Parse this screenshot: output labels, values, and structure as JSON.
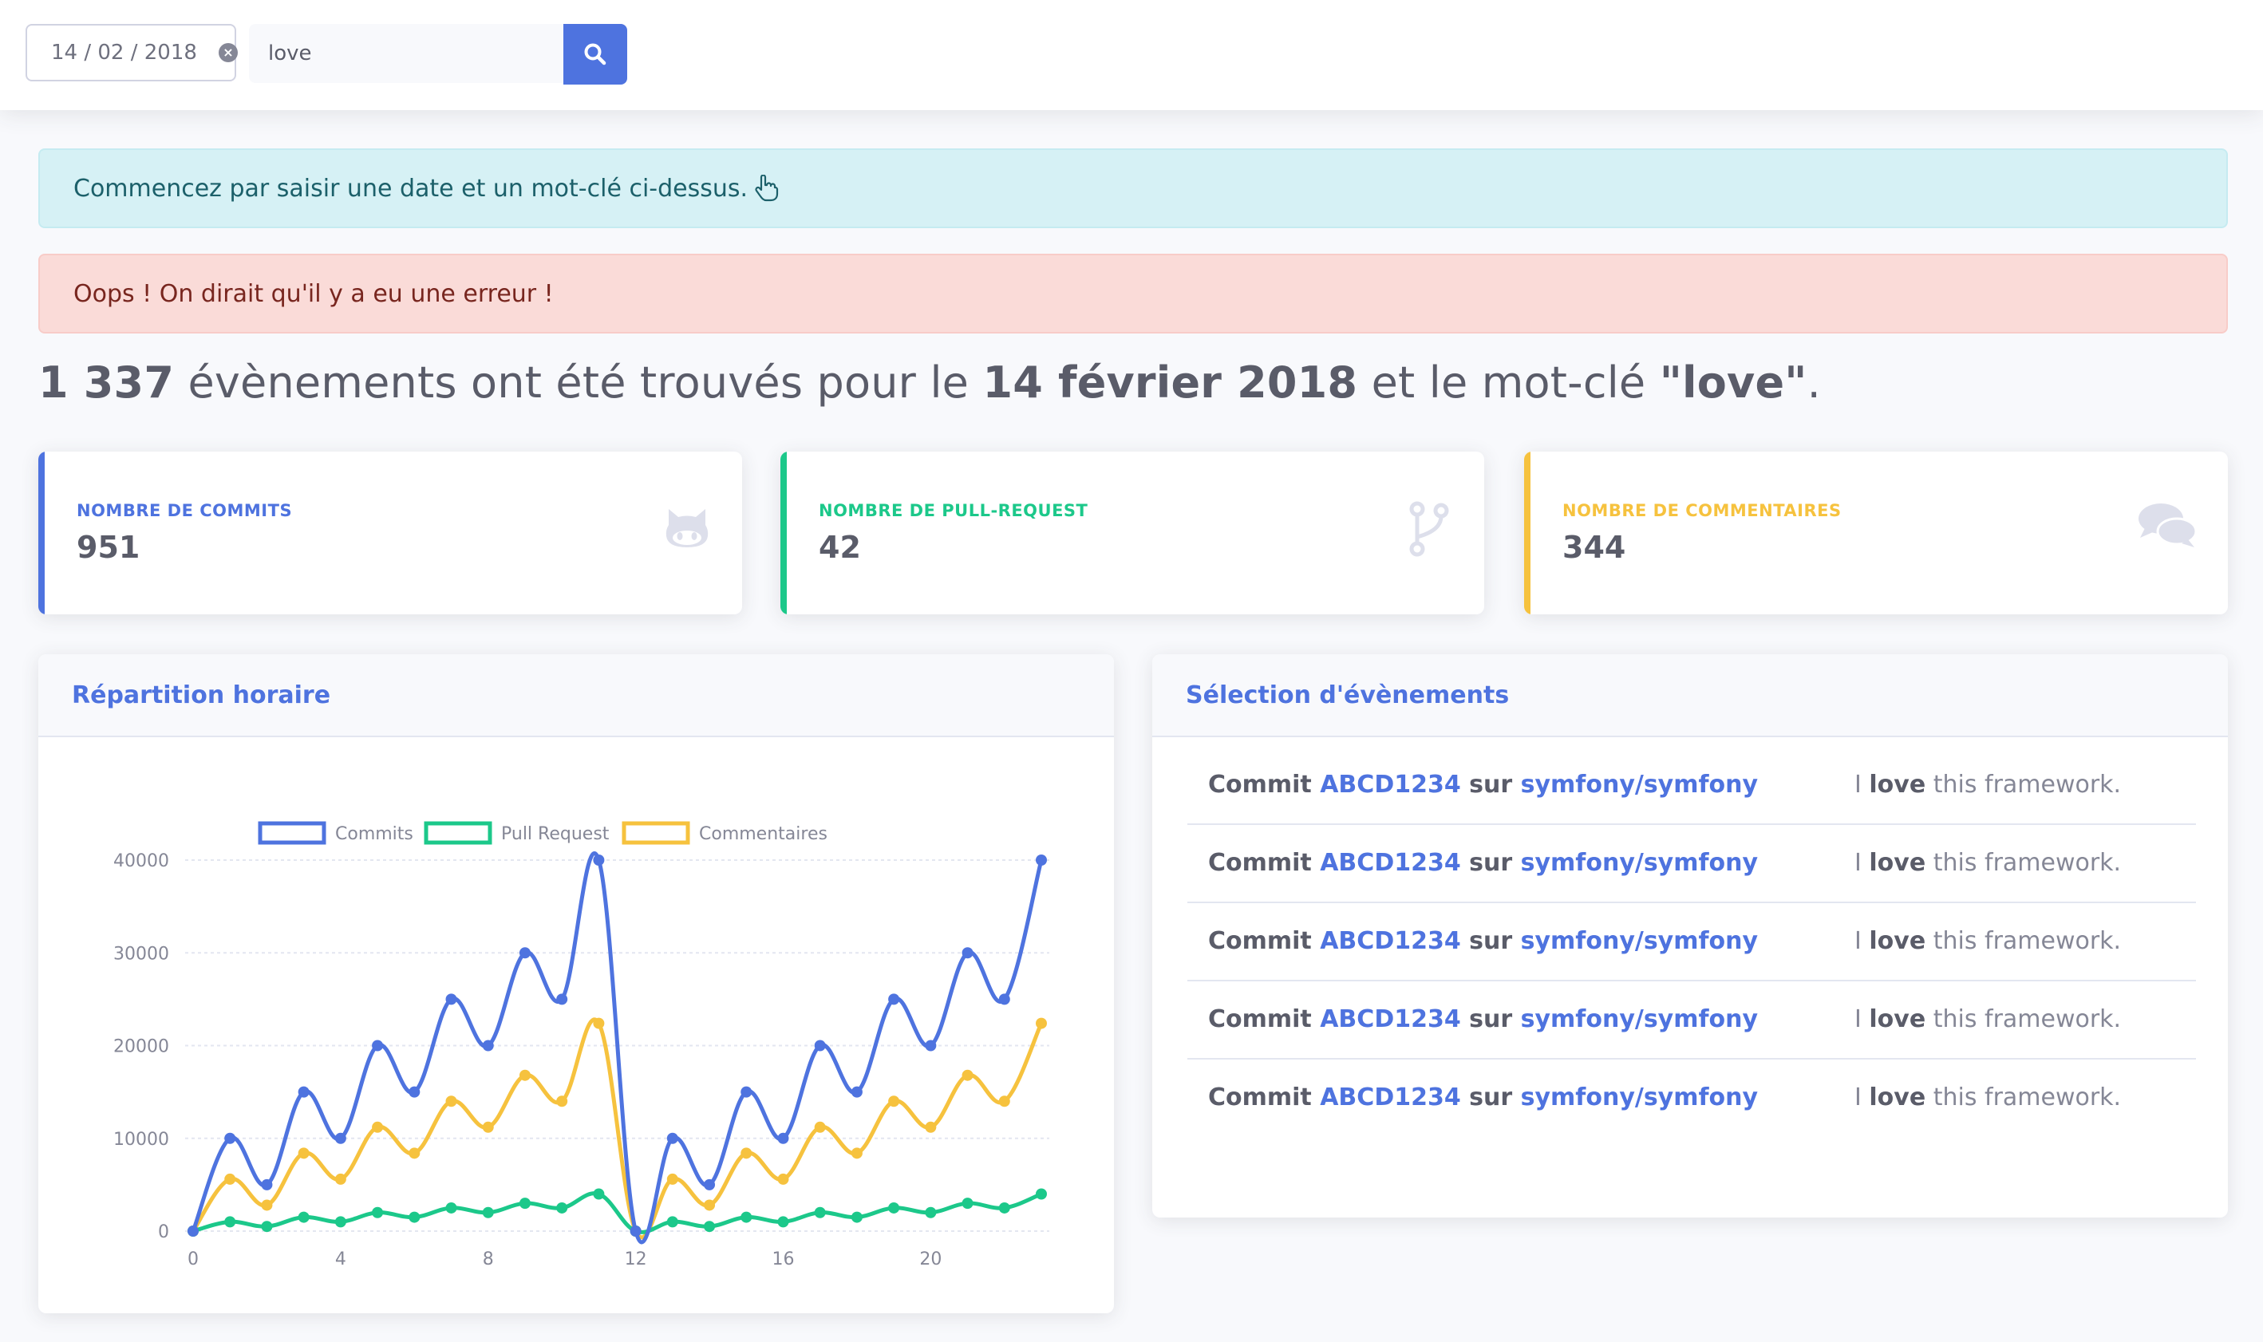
{
  "search": {
    "date_value": "14 / 02 / 2018",
    "keyword_value": "love"
  },
  "alerts": {
    "info": "Commencez par saisir une date et un mot-clé ci-dessus.",
    "danger": "Oops ! On dirait qu'il y a eu une erreur !"
  },
  "summary": {
    "count": "1 337",
    "text_1": " évènements ont été trouvés pour le ",
    "date": "14 février 2018",
    "text_2": " et le mot-clé ",
    "keyword": "\"love\"",
    "text_3": "."
  },
  "stats": [
    {
      "label": "Nombre de commits",
      "value": "951",
      "color": "#4e73df",
      "icon": "github-icon"
    },
    {
      "label": "Nombre de pull-request",
      "value": "42",
      "color": "#1cc88a",
      "icon": "code-branch-icon"
    },
    {
      "label": "Nombre de commentaires",
      "value": "344",
      "color": "#f6c23e",
      "icon": "comments-icon"
    }
  ],
  "hourly_card": {
    "title": "Répartition horaire"
  },
  "events_card": {
    "title": "Sélection d'évènements",
    "events": [
      {
        "type": "Commit",
        "hash": "ABCD1234",
        "sep": "sur",
        "repo": "symfony/symfony",
        "msg_pre": "I ",
        "msg_kw": "love",
        "msg_post": " this framework."
      },
      {
        "type": "Commit",
        "hash": "ABCD1234",
        "sep": "sur",
        "repo": "symfony/symfony",
        "msg_pre": "I ",
        "msg_kw": "love",
        "msg_post": " this framework."
      },
      {
        "type": "Commit",
        "hash": "ABCD1234",
        "sep": "sur",
        "repo": "symfony/symfony",
        "msg_pre": "I ",
        "msg_kw": "love",
        "msg_post": " this framework."
      },
      {
        "type": "Commit",
        "hash": "ABCD1234",
        "sep": "sur",
        "repo": "symfony/symfony",
        "msg_pre": "I ",
        "msg_kw": "love",
        "msg_post": " this framework."
      },
      {
        "type": "Commit",
        "hash": "ABCD1234",
        "sep": "sur",
        "repo": "symfony/symfony",
        "msg_pre": "I ",
        "msg_kw": "love",
        "msg_post": " this framework."
      }
    ]
  },
  "chart_data": {
    "type": "line",
    "x": [
      0,
      1,
      2,
      3,
      4,
      5,
      6,
      7,
      8,
      9,
      10,
      11,
      12,
      13,
      14,
      15,
      16,
      17,
      18,
      19,
      20,
      21,
      22,
      23
    ],
    "xticks": [
      0,
      4,
      8,
      12,
      16,
      20
    ],
    "yticks": [
      0,
      10000,
      20000,
      30000,
      40000
    ],
    "ylim": [
      0,
      40000
    ],
    "xlim": [
      0,
      23
    ],
    "grid": true,
    "legend_position": "top",
    "series": [
      {
        "name": "Commits",
        "color": "#4e73df",
        "values": [
          0,
          10000,
          5000,
          15000,
          10000,
          20000,
          15000,
          25000,
          20000,
          30000,
          25000,
          40000,
          0,
          10000,
          5000,
          15000,
          10000,
          20000,
          15000,
          25000,
          20000,
          30000,
          25000,
          40000
        ]
      },
      {
        "name": "Pull Request",
        "color": "#1cc88a",
        "values": [
          0,
          1000,
          500,
          1500,
          1000,
          2000,
          1500,
          2500,
          2000,
          3000,
          2500,
          4000,
          0,
          1000,
          500,
          1500,
          1000,
          2000,
          1500,
          2500,
          2000,
          3000,
          2500,
          4000
        ]
      },
      {
        "name": "Commentaires",
        "color": "#f6c23e",
        "values": [
          0,
          5600,
          2800,
          8400,
          5600,
          11200,
          8400,
          14000,
          11200,
          16800,
          14000,
          22400,
          0,
          5600,
          2800,
          8400,
          5600,
          11200,
          8400,
          14000,
          11200,
          16800,
          14000,
          22400
        ]
      }
    ]
  }
}
